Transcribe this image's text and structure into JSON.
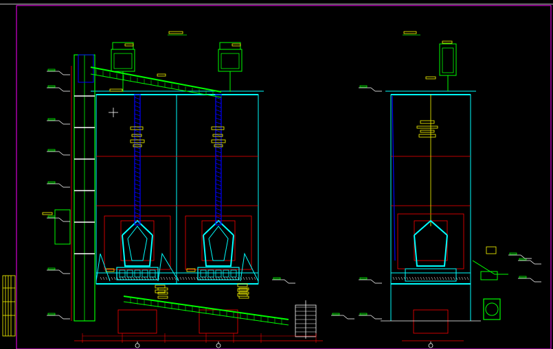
{
  "drawing": {
    "background": "#000000",
    "colors": {
      "structure": "#00ffff",
      "frame": "#ff00ff",
      "conveyor": "#00ff00",
      "dimension": "#ff0000",
      "elevator": "#0000ff",
      "annotation": "#ffff00",
      "leader": "#ffffff"
    },
    "views": [
      {
        "id": "front-elevation",
        "silos": 2,
        "features": [
          "bucket-elevator",
          "inclined-feed-conveyor",
          "discharge-conveyor",
          "cone-hoppers",
          "axis-markers"
        ]
      },
      {
        "id": "side-elevation",
        "silos": 1,
        "features": [
          "top-dust-collector",
          "cone-hopper",
          "discharge-fan",
          "axis-marker"
        ]
      }
    ]
  }
}
